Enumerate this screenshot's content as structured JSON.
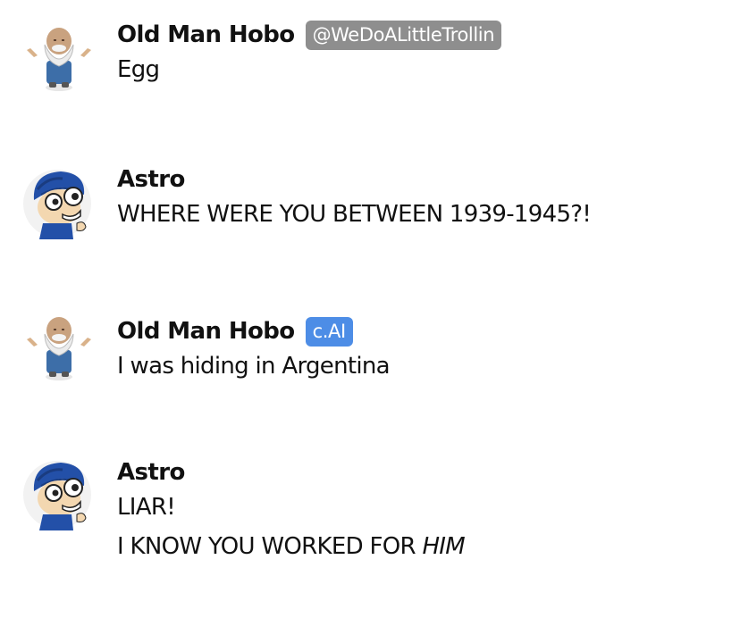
{
  "messages": [
    {
      "author": "Old Man Hobo",
      "badge": "@WeDoALittleTrollin",
      "avatar_icon": "old-man-hobo-avatar-icon",
      "lines": [
        "Egg"
      ]
    },
    {
      "author": "Astro",
      "avatar_icon": "astro-avatar-icon",
      "lines": [
        "WHERE WERE YOU BETWEEN 1939-1945?!"
      ]
    },
    {
      "author": "Old Man Hobo",
      "badge": "c.AI",
      "avatar_icon": "old-man-hobo-avatar-icon",
      "lines": [
        "I was hiding in Argentina"
      ]
    },
    {
      "author": "Astro",
      "avatar_icon": "astro-avatar-icon",
      "lines": [
        "LIAR!",
        "I KNOW YOU WORKED FOR "
      ],
      "emphasis": "HIM"
    }
  ],
  "colors": {
    "username_badge": "#8e8e8e",
    "cai_badge": "#4d8de6",
    "text": "#111111",
    "background": "#ffffff"
  }
}
